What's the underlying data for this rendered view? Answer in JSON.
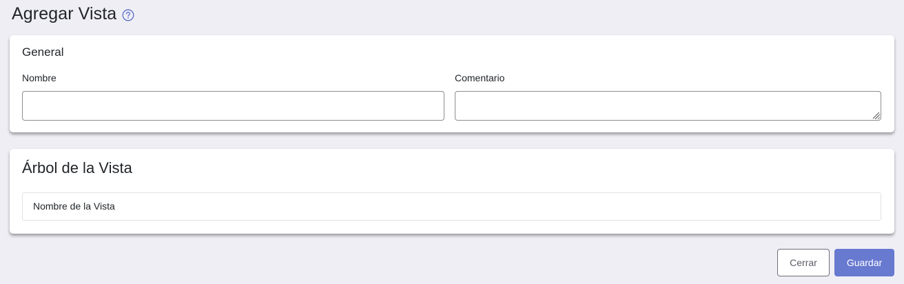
{
  "page": {
    "title": "Agregar Vista",
    "help_icon": "question-circle-icon"
  },
  "general": {
    "title": "General",
    "nombre": {
      "label": "Nombre",
      "value": "",
      "placeholder": ""
    },
    "comentario": {
      "label": "Comentario",
      "value": "",
      "placeholder": ""
    }
  },
  "tree": {
    "title": "Árbol de la Vista",
    "items": [
      "Nombre de la Vista"
    ]
  },
  "footer": {
    "cerrar_label": "Cerrar",
    "guardar_label": "Guardar"
  },
  "colors": {
    "background": "#efeef5",
    "primary": "#6879d0",
    "help_icon": "#5a6bc8"
  }
}
